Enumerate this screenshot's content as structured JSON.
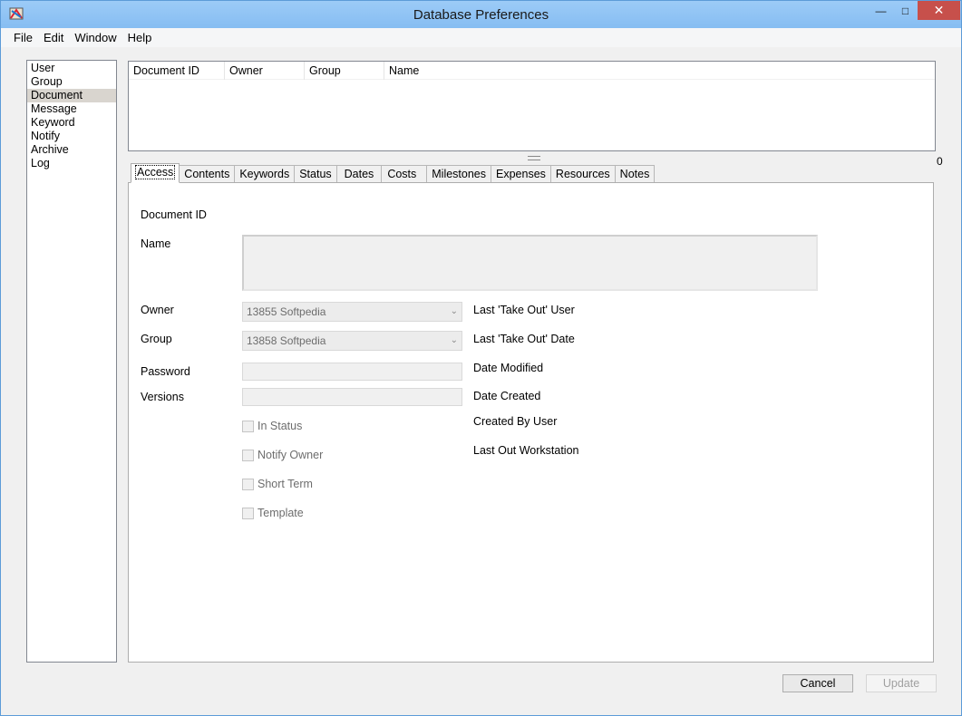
{
  "window": {
    "title": "Database Preferences",
    "caption": {
      "minimize": "—",
      "maximize": "□",
      "close": "✕"
    }
  },
  "menu": [
    "File",
    "Edit",
    "Window",
    "Help"
  ],
  "categories": {
    "items": [
      "User",
      "Group",
      "Document",
      "Message",
      "Keyword",
      "Notify",
      "Archive",
      "Log"
    ],
    "selected": "Document"
  },
  "doc_table": {
    "columns": [
      "Document ID",
      "Owner",
      "Group",
      "Name"
    ],
    "rows": [],
    "record_count": "0"
  },
  "tabs": {
    "items": [
      "Access",
      "Contents",
      "Keywords",
      "Status",
      "Dates",
      "Costs",
      "Milestones",
      "Expenses",
      "Resources",
      "Notes"
    ],
    "active": "Access"
  },
  "access": {
    "document_id_label": "Document ID",
    "name_label": "Name",
    "owner_label": "Owner",
    "owner_value": "13855 Softpedia",
    "group_label": "Group",
    "group_value": "13858 Softpedia",
    "password_label": "Password",
    "versions_label": "Versions",
    "checkboxes": [
      "In Status",
      "Notify Owner",
      "Short Term",
      "Template"
    ],
    "info_labels": [
      "Last 'Take Out' User",
      "Last 'Take Out' Date",
      "Date Modified",
      "Date Created",
      "Created By User",
      "Last Out Workstation"
    ]
  },
  "buttons": {
    "cancel": "Cancel",
    "update": "Update"
  },
  "colors": {
    "titlebar": "#8dc2f5",
    "close": "#c7504b",
    "selection": "#d9d5cf"
  }
}
